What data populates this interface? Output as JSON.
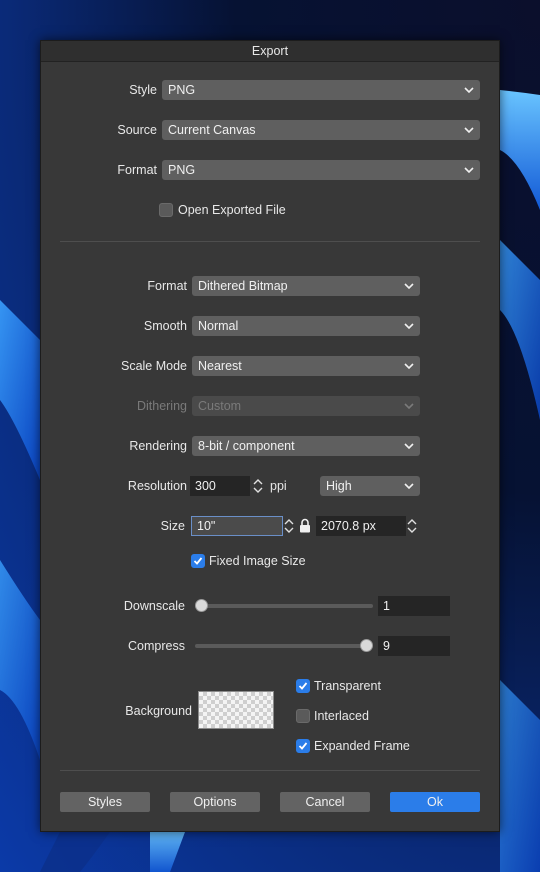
{
  "dialog": {
    "title": "Export"
  },
  "top": {
    "style": {
      "label": "Style",
      "value": "PNG"
    },
    "source": {
      "label": "Source",
      "value": "Current Canvas"
    },
    "format": {
      "label": "Format",
      "value": "PNG"
    },
    "open_exported": {
      "label": "Open Exported File",
      "checked": false
    }
  },
  "options": {
    "format": {
      "label": "Format",
      "value": "Dithered Bitmap"
    },
    "smooth": {
      "label": "Smooth",
      "value": "Normal"
    },
    "scale_mode": {
      "label": "Scale Mode",
      "value": "Nearest"
    },
    "dithering": {
      "label": "Dithering",
      "value": "Custom",
      "enabled": false
    },
    "rendering": {
      "label": "Rendering",
      "value": "8-bit / component"
    },
    "resolution": {
      "label": "Resolution",
      "value": "300",
      "unit": "ppi",
      "quality": "High"
    },
    "size": {
      "label": "Size",
      "value": "10\"",
      "pixels": "2070.8 px"
    },
    "fixed_image_size": {
      "label": "Fixed Image Size",
      "checked": true
    },
    "downscale": {
      "label": "Downscale",
      "value": "1",
      "slider_fraction": 0.0
    },
    "compress": {
      "label": "Compress",
      "value": "9",
      "slider_fraction": 1.0
    },
    "background": {
      "label": "Background"
    },
    "transparent": {
      "label": "Transparent",
      "checked": true
    },
    "interlaced": {
      "label": "Interlaced",
      "checked": false
    },
    "expanded_frame": {
      "label": "Expanded Frame",
      "checked": true
    }
  },
  "buttons": {
    "styles": "Styles",
    "options": "Options",
    "cancel": "Cancel",
    "ok": "Ok"
  },
  "colors": {
    "accent": "#2b7de9",
    "panel": "#383838",
    "control": "#5f5f5f"
  }
}
